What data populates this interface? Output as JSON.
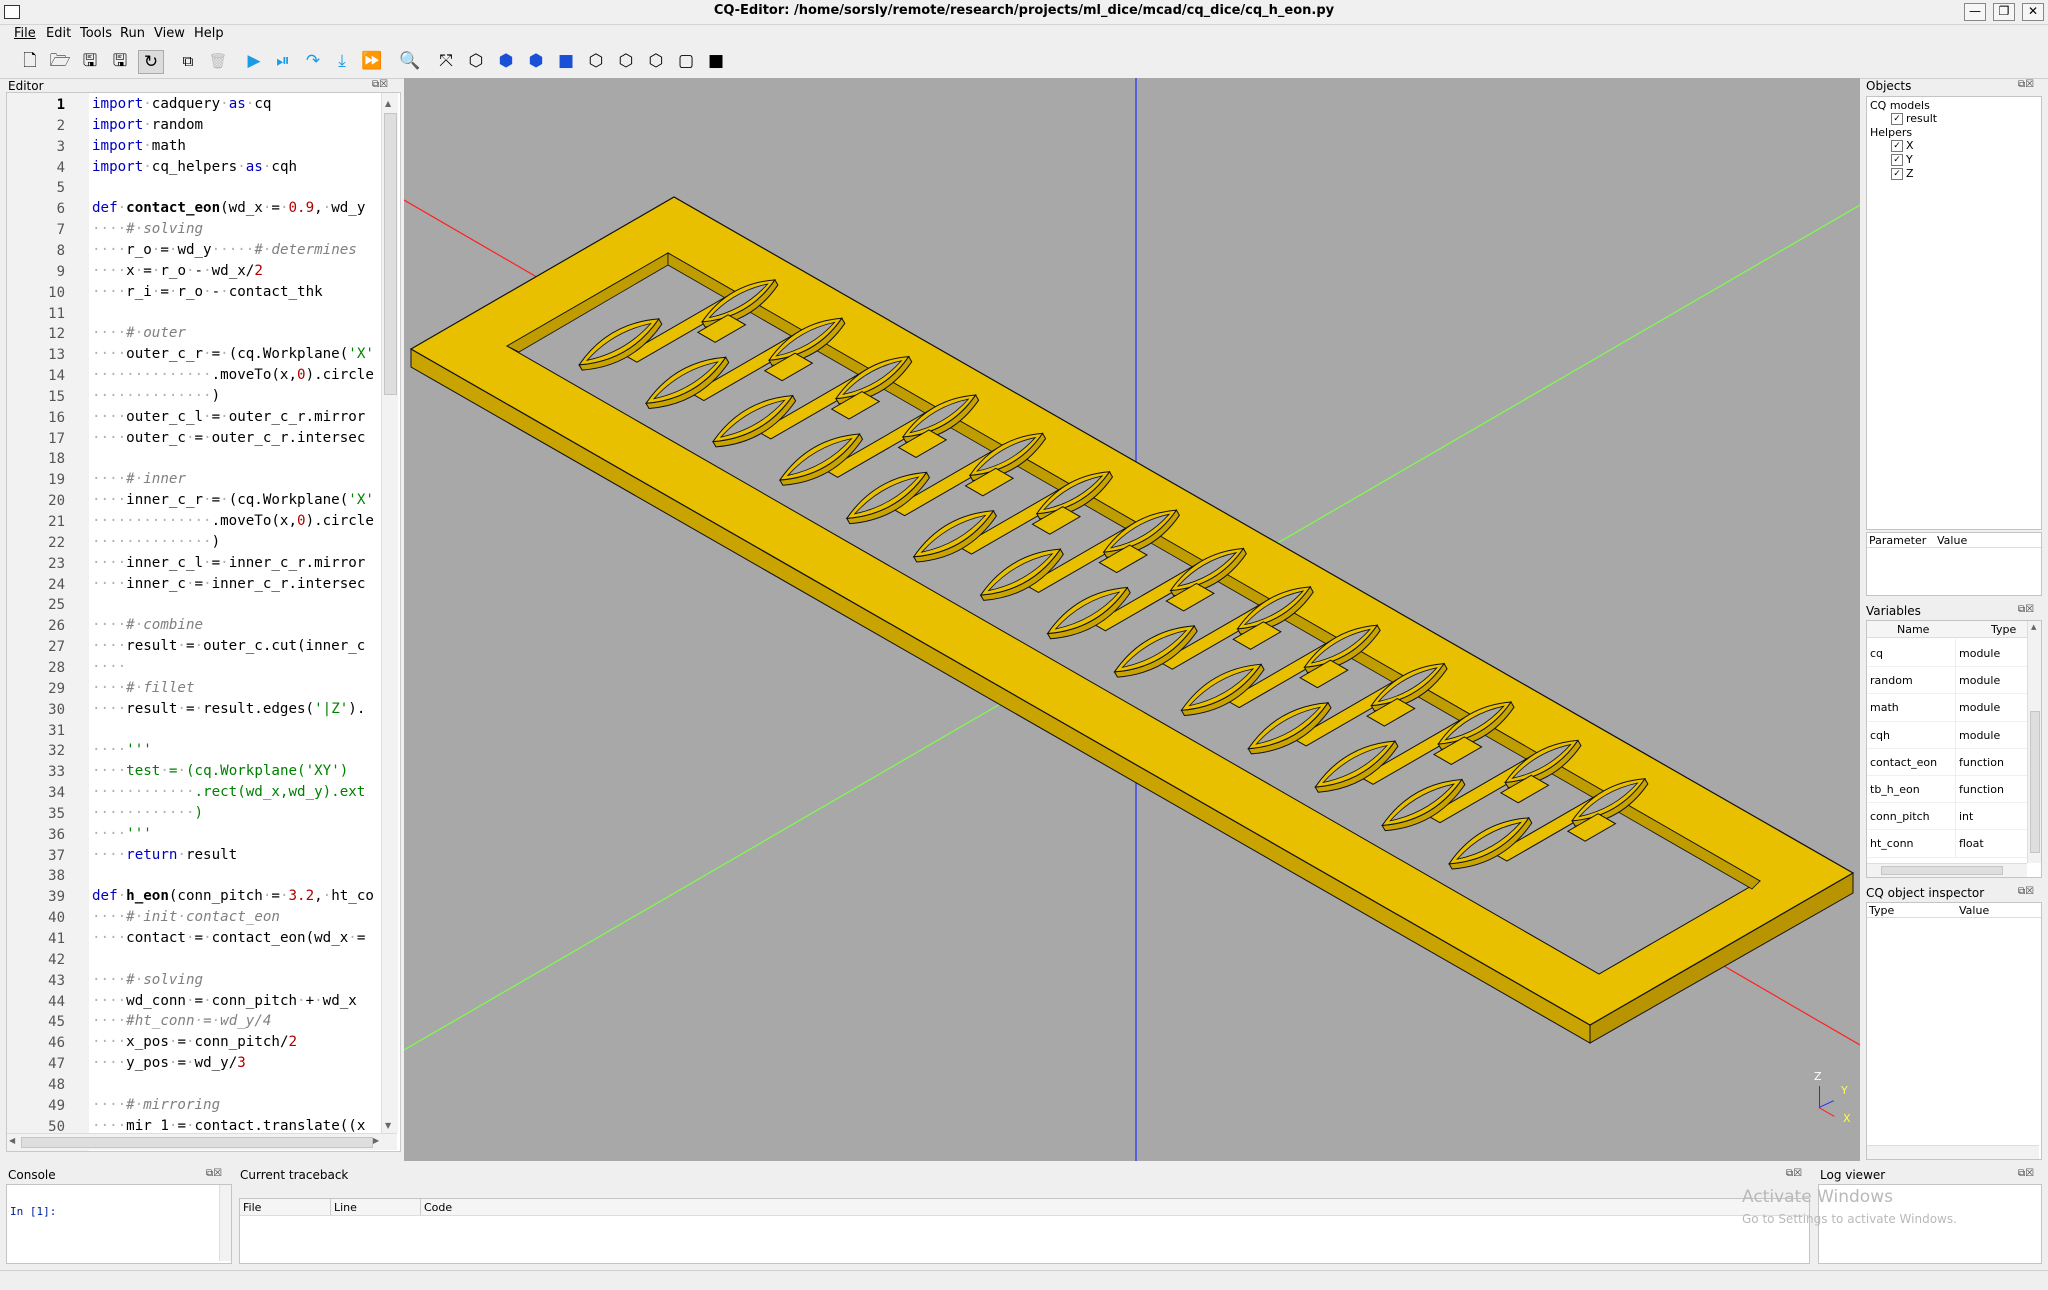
{
  "window": {
    "title": "CQ-Editor: /home/sorsly/remote/research/projects/ml_dice/mcad/cq_dice/cq_h_eon.py",
    "controls": [
      "—",
      "❐",
      "✕"
    ]
  },
  "menu": [
    "File",
    "Edit",
    "Tools",
    "Run",
    "View",
    "Help"
  ],
  "toolbar": {
    "icons": [
      "new-file-icon",
      "open-file-icon",
      "save-icon",
      "save-as-icon",
      "autoreload-icon",
      "copy-icon",
      "delete-icon",
      "render-icon",
      "debug-icon",
      "step-over-icon",
      "step-into-icon",
      "continue-icon",
      "zoom-fit-icon",
      "fit-icon",
      "iso-view-icon",
      "top-view-icon",
      "front-view-icon",
      "left-view-icon",
      "right-view-icon",
      "back-view-icon",
      "wireframe-icon",
      "shaded-icon"
    ]
  },
  "editor": {
    "title": "Editor",
    "current_line": "1",
    "lines": [
      {
        "n": "1",
        "h": "<span class=\"kw\">import</span><span class=\"dot\">·</span>cadquery<span class=\"dot\">·</span><span class=\"kw\">as</span><span class=\"dot\">·</span>cq"
      },
      {
        "n": "2",
        "h": "<span class=\"kw\">import</span><span class=\"dot\">·</span>random"
      },
      {
        "n": "3",
        "h": "<span class=\"kw\">import</span><span class=\"dot\">·</span>math"
      },
      {
        "n": "4",
        "h": "<span class=\"kw\">import</span><span class=\"dot\">·</span>cq_helpers<span class=\"dot\">·</span><span class=\"kw\">as</span><span class=\"dot\">·</span>cqh"
      },
      {
        "n": "5",
        "h": ""
      },
      {
        "n": "6",
        "h": "<span class=\"kw\">def</span><span class=\"dot\">·</span><span class=\"fn\">contact_eon</span>(wd_x<span class=\"dot\">·</span>=<span class=\"dot\">·</span><span class=\"num\">0.9</span>,<span class=\"dot\">·</span>wd_y"
      },
      {
        "n": "7",
        "h": "<span class=\"dot\">····</span><span class=\"cmt\">#<span class=\"dot\">·</span>solving</span>"
      },
      {
        "n": "8",
        "h": "<span class=\"dot\">····</span>r_o<span class=\"dot\">·</span>=<span class=\"dot\">·</span>wd_y<span class=\"dot\">·····</span><span class=\"cmt\">#<span class=\"dot\">·</span>determines</span>"
      },
      {
        "n": "9",
        "h": "<span class=\"dot\">····</span>x<span class=\"dot\">·</span>=<span class=\"dot\">·</span>r_o<span class=\"dot\">·</span>-<span class=\"dot\">·</span>wd_x/<span class=\"num\">2</span>"
      },
      {
        "n": "10",
        "h": "<span class=\"dot\">····</span>r_i<span class=\"dot\">·</span>=<span class=\"dot\">·</span>r_o<span class=\"dot\">·</span>-<span class=\"dot\">·</span>contact_thk"
      },
      {
        "n": "11",
        "h": ""
      },
      {
        "n": "12",
        "h": "<span class=\"dot\">····</span><span class=\"cmt\">#<span class=\"dot\">·</span>outer</span>"
      },
      {
        "n": "13",
        "h": "<span class=\"dot\">····</span>outer_c_r<span class=\"dot\">·</span>=<span class=\"dot\">·</span>(cq.Workplane(<span class=\"str\">'X'</span>"
      },
      {
        "n": "14",
        "h": "<span class=\"dot\">··············</span>.moveTo(x,<span class=\"num\">0</span>).circle"
      },
      {
        "n": "15",
        "h": "<span class=\"dot\">··············</span>)"
      },
      {
        "n": "16",
        "h": "<span class=\"dot\">····</span>outer_c_l<span class=\"dot\">·</span>=<span class=\"dot\">·</span>outer_c_r.mirror"
      },
      {
        "n": "17",
        "h": "<span class=\"dot\">····</span>outer_c<span class=\"dot\">·</span>=<span class=\"dot\">·</span>outer_c_r.intersec"
      },
      {
        "n": "18",
        "h": ""
      },
      {
        "n": "19",
        "h": "<span class=\"dot\">····</span><span class=\"cmt\">#<span class=\"dot\">·</span>inner</span>"
      },
      {
        "n": "20",
        "h": "<span class=\"dot\">····</span>inner_c_r<span class=\"dot\">·</span>=<span class=\"dot\">·</span>(cq.Workplane(<span class=\"str\">'X'</span>"
      },
      {
        "n": "21",
        "h": "<span class=\"dot\">··············</span>.moveTo(x,<span class=\"num\">0</span>).circle"
      },
      {
        "n": "22",
        "h": "<span class=\"dot\">··············</span>)"
      },
      {
        "n": "23",
        "h": "<span class=\"dot\">····</span>inner_c_l<span class=\"dot\">·</span>=<span class=\"dot\">·</span>inner_c_r.mirror"
      },
      {
        "n": "24",
        "h": "<span class=\"dot\">····</span>inner_c<span class=\"dot\">·</span>=<span class=\"dot\">·</span>inner_c_r.intersec"
      },
      {
        "n": "25",
        "h": ""
      },
      {
        "n": "26",
        "h": "<span class=\"dot\">····</span><span class=\"cmt\">#<span class=\"dot\">·</span>combine</span>"
      },
      {
        "n": "27",
        "h": "<span class=\"dot\">····</span>result<span class=\"dot\">·</span>=<span class=\"dot\">·</span>outer_c.cut(inner_c"
      },
      {
        "n": "28",
        "h": "<span class=\"dot\">····</span>"
      },
      {
        "n": "29",
        "h": "<span class=\"dot\">····</span><span class=\"cmt\">#<span class=\"dot\">·</span>fillet</span>"
      },
      {
        "n": "30",
        "h": "<span class=\"dot\">····</span>result<span class=\"dot\">·</span>=<span class=\"dot\">·</span>result.edges(<span class=\"str\">'|Z'</span>)."
      },
      {
        "n": "31",
        "h": ""
      },
      {
        "n": "32",
        "h": "<span class=\"dot\">····</span><span class=\"str\">'''</span>"
      },
      {
        "n": "33",
        "h": "<span class=\"str\"><span class=\"dot\">····</span>test<span class=\"dot\">·</span>=<span class=\"dot\">·</span>(cq.Workplane('XY')</span>"
      },
      {
        "n": "34",
        "h": "<span class=\"str\"><span class=\"dot\">············</span>.rect(wd_x,wd_y).ext</span>"
      },
      {
        "n": "35",
        "h": "<span class=\"str\"><span class=\"dot\">············</span>)</span>"
      },
      {
        "n": "36",
        "h": "<span class=\"dot\">····</span><span class=\"str\">'''</span>"
      },
      {
        "n": "37",
        "h": "<span class=\"dot\">····</span><span class=\"kw\">return</span><span class=\"dot\">·</span>result"
      },
      {
        "n": "38",
        "h": ""
      },
      {
        "n": "39",
        "h": "<span class=\"kw\">def</span><span class=\"dot\">·</span><span class=\"fn\">h_eon</span>(conn_pitch<span class=\"dot\">·</span>=<span class=\"dot\">·</span><span class=\"num\">3.2</span>,<span class=\"dot\">·</span>ht_co"
      },
      {
        "n": "40",
        "h": "<span class=\"dot\">····</span><span class=\"cmt\">#<span class=\"dot\">·</span>init<span class=\"dot\">·</span>contact_eon</span>"
      },
      {
        "n": "41",
        "h": "<span class=\"dot\">····</span>contact<span class=\"dot\">·</span>=<span class=\"dot\">·</span>contact_eon(wd_x<span class=\"dot\">·</span>="
      },
      {
        "n": "42",
        "h": ""
      },
      {
        "n": "43",
        "h": "<span class=\"dot\">····</span><span class=\"cmt\">#<span class=\"dot\">·</span>solving</span>"
      },
      {
        "n": "44",
        "h": "<span class=\"dot\">····</span>wd_conn<span class=\"dot\">·</span>=<span class=\"dot\">·</span>conn_pitch<span class=\"dot\">·</span>+<span class=\"dot\">·</span>wd_x"
      },
      {
        "n": "45",
        "h": "<span class=\"dot\">····</span><span class=\"cmt\">#ht_conn<span class=\"dot\">·</span>=<span class=\"dot\">·</span>wd_y/4</span>"
      },
      {
        "n": "46",
        "h": "<span class=\"dot\">····</span>x_pos<span class=\"dot\">·</span>=<span class=\"dot\">·</span>conn_pitch/<span class=\"num\">2</span>"
      },
      {
        "n": "47",
        "h": "<span class=\"dot\">····</span>y_pos<span class=\"dot\">·</span>=<span class=\"dot\">·</span>wd_y/<span class=\"num\">3</span>"
      },
      {
        "n": "48",
        "h": ""
      },
      {
        "n": "49",
        "h": "<span class=\"dot\">····</span><span class=\"cmt\">#<span class=\"dot\">·</span>mirroring</span>"
      },
      {
        "n": "50",
        "h": "<span class=\"dot\">····</span>mir_1<span class=\"dot\">·</span>=<span class=\"dot\">·</span>contact.translate((x_"
      }
    ]
  },
  "objects": {
    "title": "Objects",
    "groups": [
      {
        "label": "CQ models",
        "items": [
          "result"
        ]
      },
      {
        "label": "Helpers",
        "items": [
          "X",
          "Y",
          "Z"
        ]
      }
    ],
    "param_headers": [
      "Parameter",
      "Value"
    ]
  },
  "variables": {
    "title": "Variables",
    "headers": [
      "Name",
      "Type"
    ],
    "rows": [
      {
        "name": "cq",
        "type": "module"
      },
      {
        "name": "random",
        "type": "module"
      },
      {
        "name": "math",
        "type": "module"
      },
      {
        "name": "cqh",
        "type": "module"
      },
      {
        "name": "contact_eon",
        "type": "function"
      },
      {
        "name": "tb_h_eon",
        "type": "function"
      },
      {
        "name": "conn_pitch",
        "type": "int"
      },
      {
        "name": "ht_conn",
        "type": "float"
      }
    ]
  },
  "inspector": {
    "title": "CQ object inspector",
    "headers": [
      "Type",
      "Value"
    ]
  },
  "console": {
    "title": "Console",
    "prompt": "In [1]:"
  },
  "traceback": {
    "title": "Current traceback",
    "headers": [
      "File",
      "Line",
      "Code"
    ]
  },
  "logviewer": {
    "title": "Log viewer"
  },
  "watermark": {
    "line1": "Activate Windows",
    "line2": "Go to Settings to activate Windows."
  },
  "axes_triad": {
    "x": "X",
    "y": "Y",
    "z": "Z"
  },
  "colors": {
    "model": "#e8c000",
    "viewport": "#a8a8a8",
    "axis_x": "#ff2020",
    "axis_y": "#7cff4a",
    "axis_z": "#2030ff"
  }
}
